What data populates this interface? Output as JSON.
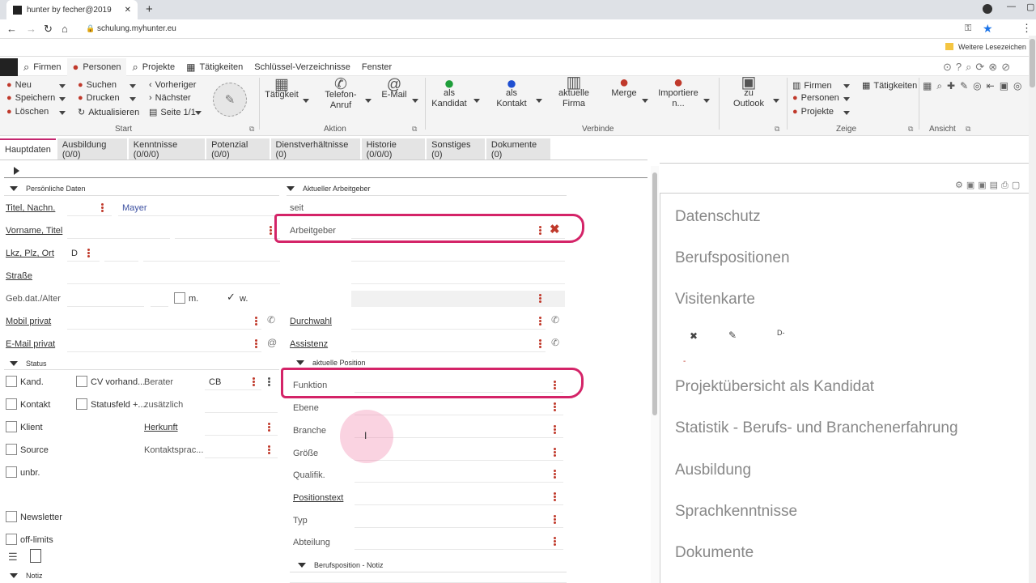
{
  "browser": {
    "tab_title": "hunter by fecher@2019",
    "url": "schulung.myhunter.eu",
    "bookmarks_label": "Weitere Lesezeichen"
  },
  "menu": {
    "firmen": "Firmen",
    "personen": "Personen",
    "projekte": "Projekte",
    "taetigkeiten": "Tätigkeiten",
    "schluessel": "Schlüssel-Verzeichnisse",
    "fenster": "Fenster"
  },
  "ribbon": {
    "neu": "Neu",
    "speichern": "Speichern",
    "loeschen": "Löschen",
    "suchen": "Suchen",
    "drucken": "Drucken",
    "aktualisieren": "Aktualisieren",
    "vorheriger": "Vorheriger",
    "naechster": "Nächster",
    "seite": "Seite 1/1",
    "taetigkeit": "Tätigkeit",
    "telefon1": "Telefon-",
    "telefon2": "Anruf",
    "email": "E-Mail",
    "kandidat1": "als",
    "kandidat2": "Kandidat",
    "kontakt1": "als",
    "kontakt2": "Kontakt",
    "firma1": "aktuelle",
    "firma2": "Firma",
    "merge": "Merge",
    "importiere1": "Importiere",
    "importiere2": "n...",
    "outlook1": "zu",
    "outlook2": "Outlook",
    "zeige_firmen": "Firmen",
    "zeige_personen": "Personen",
    "zeige_projekte": "Projekte",
    "zeige_taetigkeiten": "Tätigkeiten",
    "grp_start": "Start",
    "grp_aktion": "Aktion",
    "grp_verbinde": "Verbinde",
    "grp_zeige": "Zeige",
    "grp_ansicht": "Ansicht"
  },
  "tabs": [
    "Hauptdaten",
    "Ausbildung (0/0)",
    "Kenntnisse (0/0/0)",
    "Potenzial (0/0)",
    "Dienstverhältnisse (0)",
    "Historie (0/0/0)",
    "Sonstiges (0)",
    "Dokumente (0)"
  ],
  "form": {
    "sec_persoenlich": "Persönliche Daten",
    "sec_arbeitgeber": "Aktueller Arbeitgeber",
    "sec_status": "Status",
    "sec_position": "aktuelle Position",
    "sec_notiz_pos": "Berufsposition - Notiz",
    "sec_notiz": "Notiz",
    "titel_label": "Titel, Nachn.",
    "nachname": "Mayer",
    "vorname_label": "Vorname, Titel",
    "lkz_label": "Lkz, Plz, Ort",
    "lkz": "D",
    "strasse_label": "Straße",
    "geb_label": "Geb.dat./Alter",
    "m": "m.",
    "w": "w.",
    "mobil_label": "Mobil privat",
    "email_label": "E-Mail privat",
    "seit": "seit",
    "arbeitgeber": "Arbeitgeber",
    "durchwahl": "Durchwahl",
    "assistenz": "Assistenz",
    "kand": "Kand.",
    "kontakt": "Kontakt",
    "klient": "Klient",
    "source": "Source",
    "unbr": "unbr.",
    "newsletter": "Newsletter",
    "offlimits": "off-limits",
    "cv": "CV vorhand...",
    "statusfeld": "Statusfeld +...",
    "berater": "Berater",
    "berater_val": "CB",
    "zusaetzlich": "zusätzlich",
    "herkunft": "Herkunft",
    "kontaktsprache": "Kontaktsprac...",
    "funktion": "Funktion",
    "ebene": "Ebene",
    "branche": "Branche",
    "groesse": "Größe",
    "qualifik": "Qualifik.",
    "positionstext": "Positionstext",
    "typ": "Typ",
    "abteilung": "Abteilung"
  },
  "right_panel": {
    "items": [
      "Datenschutz",
      "Berufspositionen",
      "Visitenkarte",
      "Projektübersicht als Kandidat",
      "Statistik - Berufs- und Branchenerfahrung",
      "Ausbildung",
      "Sprachkenntnisse",
      "Dokumente"
    ],
    "vcard_text": "D-",
    "vcard_dash": "-"
  },
  "colors": {
    "accent": "#c5266f",
    "highlight": "#d42468",
    "ribbon_bg": "#f4f4f4",
    "kebab": "#c0392b"
  }
}
